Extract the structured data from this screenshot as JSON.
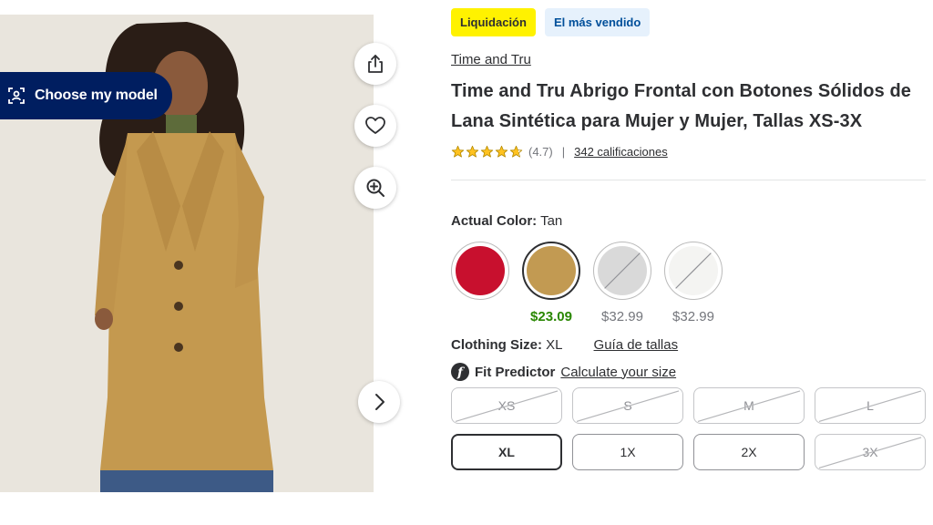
{
  "media": {
    "choose_model_label": "Choose my model",
    "tools": [
      {
        "icon": "share-icon"
      },
      {
        "icon": "heart-icon"
      },
      {
        "icon": "zoom-in-icon"
      }
    ],
    "next_icon": "chevron-right-icon"
  },
  "badges": [
    "Liquidación",
    "El más vendido"
  ],
  "brand": "Time and Tru",
  "title": "Time and Tru Abrigo Frontal con Botones Sólidos de Lana Sintética para Mujer y Mujer, Tallas XS-3X",
  "rating": {
    "stars": 4.7,
    "value_text": "(4.7)",
    "separator": "|",
    "count_text": "342 calificaciones"
  },
  "color": {
    "label": "Actual Color:",
    "value": "Tan",
    "swatches": [
      {
        "color": "#c8102e",
        "price": "",
        "available": true,
        "selected": false
      },
      {
        "color": "#c29a52",
        "price": "$23.09",
        "available": true,
        "selected": true
      },
      {
        "color": "#d9d9d9",
        "price": "$32.99",
        "available": false,
        "selected": false
      },
      {
        "color": "#f4f4f2",
        "price": "$32.99",
        "available": false,
        "selected": false
      }
    ]
  },
  "size": {
    "label": "Clothing Size:",
    "value": "XL",
    "guide_link": "Guía de tallas",
    "fit_label": "Fit Predictor",
    "fit_link": "Calculate your size",
    "options": [
      {
        "label": "XS",
        "available": false,
        "selected": false
      },
      {
        "label": "S",
        "available": false,
        "selected": false
      },
      {
        "label": "M",
        "available": false,
        "selected": false
      },
      {
        "label": "L",
        "available": false,
        "selected": false
      },
      {
        "label": "XL",
        "available": true,
        "selected": true
      },
      {
        "label": "1X",
        "available": true,
        "selected": false
      },
      {
        "label": "2X",
        "available": true,
        "selected": false
      },
      {
        "label": "3X",
        "available": false,
        "selected": false
      }
    ]
  },
  "colors": {
    "navy": "#001e60",
    "price_green": "#2a8703",
    "clearance_yellow": "#fff200",
    "star_yellow": "#ffc220"
  }
}
